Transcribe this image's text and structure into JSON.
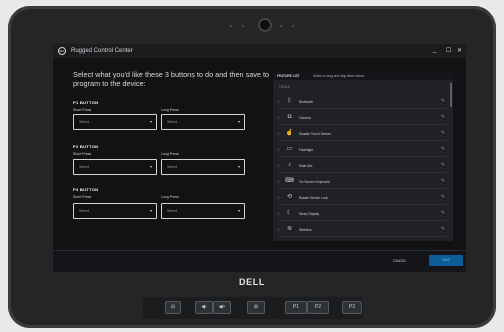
{
  "app": {
    "title": "Rugged Control Center",
    "logo": "DELL",
    "minimize": "_",
    "maximize": "☐",
    "close": "✕"
  },
  "main": {
    "heading": "Select what you'd like these 3 buttons to do and then save to program to the device:",
    "buttons": [
      {
        "title": "P1 BUTTON",
        "short_label": "Short Press",
        "long_label": "Long Press",
        "short_value": "Select",
        "long_value": "Select"
      },
      {
        "title": "P2 BUTTON",
        "short_label": "Short Press",
        "long_label": "Long Press",
        "short_value": "Select",
        "long_value": "Select"
      },
      {
        "title": "P3 BUTTON",
        "short_label": "Short Press",
        "long_label": "Long Press",
        "short_value": "Select",
        "long_value": "Select"
      }
    ]
  },
  "tools": {
    "header_title": "FEATURE LIST",
    "header_hint": "Select or drag and drop items below",
    "category": "TOOLS",
    "items": [
      {
        "label": "Bluetooth",
        "icon": "bluetooth-icon",
        "glyph": "ᛒ"
      },
      {
        "label": "Camera",
        "icon": "camera-icon",
        "glyph": "◘"
      },
      {
        "label": "Disable Touch Screen",
        "icon": "touch-off-icon",
        "glyph": "☝"
      },
      {
        "label": "Flashlight",
        "icon": "flashlight-icon",
        "glyph": "▭"
      },
      {
        "label": "Mute Mic",
        "icon": "mic-mute-icon",
        "glyph": "♪"
      },
      {
        "label": "On Screen Keyboard",
        "icon": "keyboard-icon",
        "glyph": "⌨"
      },
      {
        "label": "Rotate Screen Lock",
        "icon": "rotate-lock-icon",
        "glyph": "⟲"
      },
      {
        "label": "Sleep Display",
        "icon": "moon-icon",
        "glyph": "☾"
      },
      {
        "label": "Wireless",
        "icon": "wifi-icon",
        "glyph": "≋"
      }
    ]
  },
  "footer": {
    "cancel": "CANCEL",
    "save": "SAVE"
  },
  "device": {
    "brand": "DELL",
    "keys": {
      "window": "⊟",
      "vol_down": "◀-",
      "vol_up": "◀+",
      "windows": "⊞",
      "p1": "P1",
      "p2": "P2",
      "p3": "P3"
    }
  }
}
